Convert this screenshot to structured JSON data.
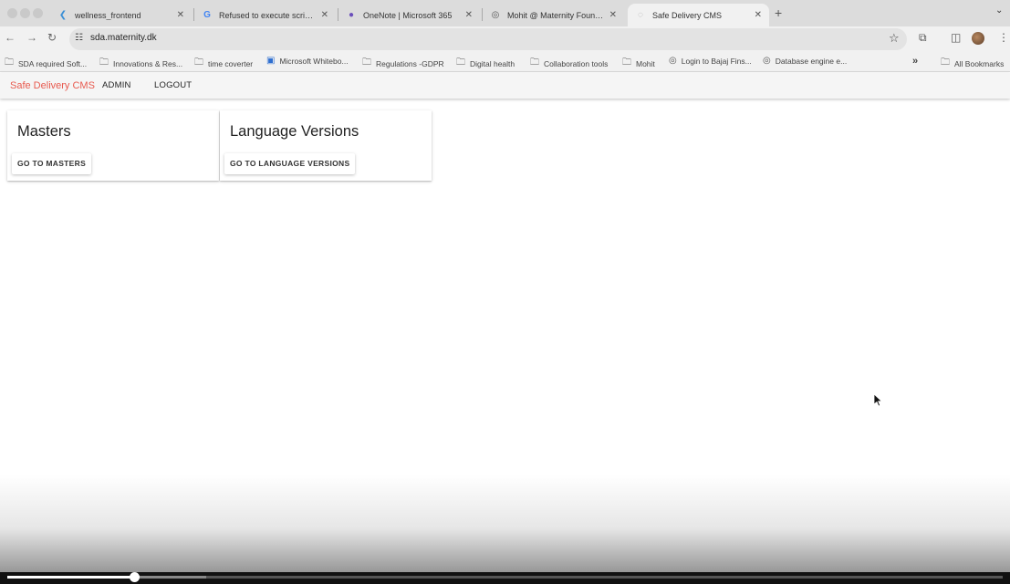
{
  "browser": {
    "tabs": [
      {
        "label": "wellness_frontend",
        "icon": "flutter-icon",
        "active": false
      },
      {
        "label": "Refused to execute script wi",
        "icon": "google-icon",
        "active": false
      },
      {
        "label": "OneNote | Microsoft 365",
        "icon": "onenote-icon",
        "active": false
      },
      {
        "label": "Mohit @ Maternity Foundatio",
        "icon": "globe-icon",
        "active": false
      },
      {
        "label": "Safe Delivery CMS",
        "icon": "loading-icon",
        "active": true
      }
    ],
    "url": "sda.maternity.dk",
    "bookmarks": [
      {
        "label": "SDA required Soft...",
        "icon": "folder-icon"
      },
      {
        "label": "Innovations & Res...",
        "icon": "folder-icon"
      },
      {
        "label": "time coverter",
        "icon": "folder-icon"
      },
      {
        "label": "Microsoft Whitebo...",
        "icon": "whiteboard-icon"
      },
      {
        "label": "Regulations -GDPR",
        "icon": "folder-icon"
      },
      {
        "label": "Digital health",
        "icon": "folder-icon"
      },
      {
        "label": "Collaboration tools",
        "icon": "folder-icon"
      },
      {
        "label": "Mohit",
        "icon": "folder-icon"
      },
      {
        "label": "Login to Bajaj Fins...",
        "icon": "globe-icon"
      },
      {
        "label": "Database engine e...",
        "icon": "globe-icon"
      }
    ],
    "all_bookmarks_label": "All Bookmarks"
  },
  "appbar": {
    "brand": "Safe Delivery CMS",
    "links": [
      "ADMIN",
      "LOGOUT"
    ],
    "brand_color": "#e85a4f"
  },
  "cards": [
    {
      "title": "Masters",
      "button": "GO TO MASTERS"
    },
    {
      "title": "Language Versions",
      "button": "GO TO LANGUAGE VERSIONS"
    }
  ],
  "video": {
    "played_fraction": 0.127,
    "buffered_fraction": 0.2
  }
}
